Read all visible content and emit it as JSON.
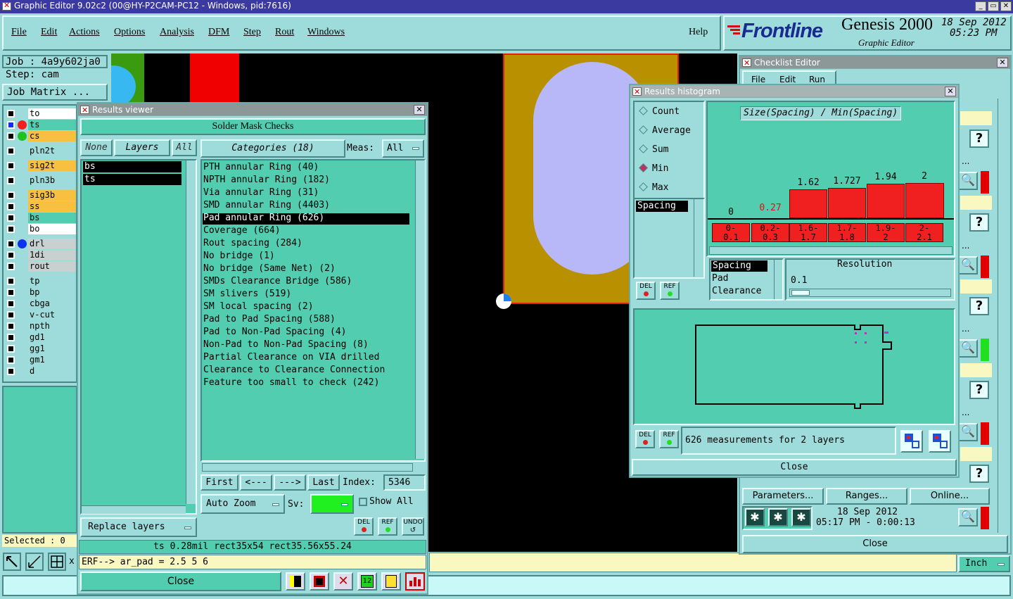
{
  "app": {
    "title": "Graphic Editor 9.02c2 (00@HY-P2CAM-PC12 - Windows, pid:7616)",
    "menu": [
      "File",
      "Edit",
      "Actions",
      "Options",
      "Analysis",
      "DFM",
      "Step",
      "Rout",
      "Windows"
    ],
    "help": "Help",
    "brand": "Frontline",
    "product": "Genesis 2000",
    "product_sub": "Graphic Editor",
    "date": "18 Sep 2012",
    "time": "05:23 PM"
  },
  "job": {
    "job_label": "Job : 4a9y602ja0",
    "step_label": "Step: cam",
    "matrix_btn": "Job Matrix ..."
  },
  "layers": [
    "to",
    "ts",
    "cs",
    "pln2t",
    "sig2t",
    "pln3b",
    "sig3b",
    "ss",
    "bs",
    "bo",
    "drl",
    "1di",
    "rout",
    "tp",
    "bp",
    "cbga",
    "v-cut",
    "npth",
    "gd1",
    "gg1",
    "gm1",
    "d"
  ],
  "selected_label": "Selected : 0",
  "results_viewer": {
    "title": "Results viewer",
    "heading": "Solder Mask Checks",
    "none_btn": "None",
    "layers_btn": "Layers",
    "all_btn": "All",
    "layer_items": [
      "bs",
      "ts"
    ],
    "categories_btn": "Categories (18)",
    "meas_label": "Meas:",
    "meas_value": "All",
    "categories": [
      "PTH annular Ring (40)",
      "NPTH annular Ring (182)",
      "Via annular Ring (31)",
      "SMD annular Ring (4403)",
      "Pad annular Ring (626)",
      "Coverage (664)",
      "Rout spacing (284)",
      "No bridge (1)",
      "No bridge (Same Net) (2)",
      "SMDs Clearance Bridge (586)",
      "SM slivers (519)",
      "SM local spacing (2)",
      "Pad to Pad Spacing (588)",
      "Pad to Non-Pad Spacing (4)",
      "Non-Pad to Non-Pad Spacing (8)",
      "Partial Clearance on VIA drilled",
      "Clearance to Clearance Connection",
      "Feature too small to check (242)"
    ],
    "first_btn": "First",
    "prev_btn": "<---",
    "next_btn": "--->",
    "last_btn": "Last",
    "index_label": "Index:",
    "index_value": "5346",
    "auto_zoom": "Auto Zoom",
    "sv_label": "Sv:",
    "show_all": "Show All",
    "replace_layers": "Replace layers",
    "del": "DEL",
    "ref": "REF",
    "undo": "UNDO",
    "status": "ts 0.28mil   rect35x54   rect35.56x55.24",
    "close": "Close"
  },
  "command_line": "ERF--> ar_pad = 2.5 5 6",
  "command_prefix": "x",
  "histogram": {
    "title": "Results histogram",
    "radios": [
      {
        "label": "Count",
        "on": false
      },
      {
        "label": "Average",
        "on": false
      },
      {
        "label": "Sum",
        "on": false
      },
      {
        "label": "Min",
        "on": true
      },
      {
        "label": "Max",
        "on": false
      }
    ],
    "measure_item": "Spacing",
    "chart_title": "Size(Spacing) / Min(Spacing)",
    "bins": [
      {
        "value": "0",
        "l1": "",
        "l2": ""
      },
      {
        "value": "0.27",
        "l1": "0-",
        "l2": "0.1"
      },
      {
        "value": "1.62",
        "l1": "0.2-",
        "l2": "0.3"
      },
      {
        "value": "1.727",
        "l1": "1.6-",
        "l2": "1.7"
      },
      {
        "value": "1.94",
        "l1": "1.7-",
        "l2": "1.8"
      },
      {
        "value": "2",
        "l1": "1.9-",
        "l2": "2"
      },
      {
        "value": "",
        "l1": "2-",
        "l2": "2.1"
      }
    ],
    "list_items": [
      "Spacing",
      "Pad",
      "Clearance"
    ],
    "resolution_label": "Resolution",
    "resolution_value": "0.1",
    "del": "DEL",
    "ref": "REF",
    "summary": "626 measurements for 2 layers",
    "close": "Close"
  },
  "checklist": {
    "title": "Checklist Editor",
    "menu": [
      "File",
      "Edit",
      "Run"
    ],
    "parameters_btn": "Parameters...",
    "ranges_btn": "Ranges...",
    "online_btn": "Online...",
    "run_date": "18 Sep 2012",
    "run_time": "05:17 PM - 0:00:13",
    "close": "Close",
    "ellipsis": "..."
  },
  "units": "Inch"
}
